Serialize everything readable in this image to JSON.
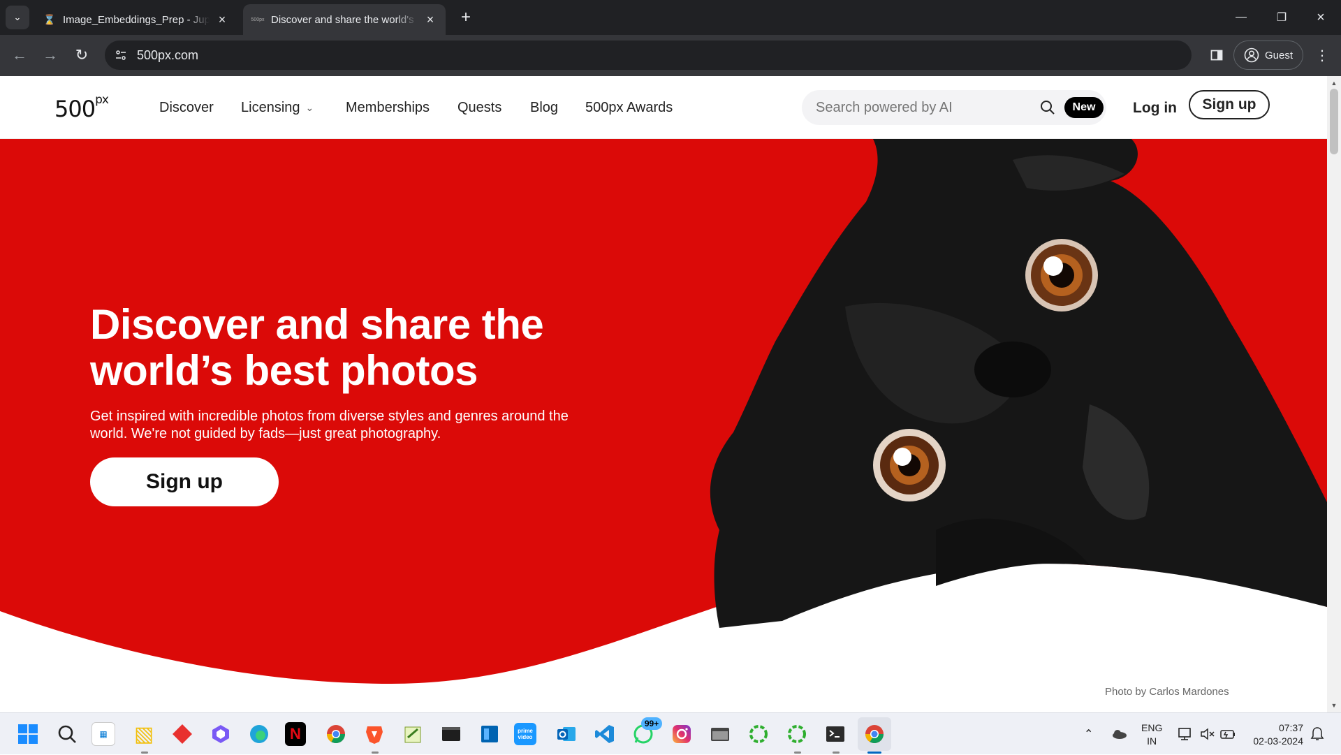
{
  "browser": {
    "tabs": [
      {
        "title": "Image_Embeddings_Prep - Jupyter",
        "icon": "hourglass-icon",
        "active": false
      },
      {
        "title": "Discover and share the world's best photos",
        "icon": "500px-favicon",
        "active": true
      }
    ],
    "new_tab_symbol": "+",
    "url": "500px.com",
    "profile_label": "Guest"
  },
  "site": {
    "logo_main": "500",
    "logo_sup": "px",
    "nav": [
      {
        "label": "Discover"
      },
      {
        "label": "Licensing",
        "has_dropdown": true
      },
      {
        "label": "Memberships"
      },
      {
        "label": "Quests"
      },
      {
        "label": "Blog"
      },
      {
        "label": "500px Awards"
      }
    ],
    "search_placeholder": "Search powered by AI",
    "new_badge": "New",
    "login_label": "Log in",
    "signup_label": "Sign up"
  },
  "hero": {
    "title": "Discover and share the world’s best photos",
    "subtitle": "Get inspired with incredible photos from diverse styles and genres around the world. We're not guided by fads—just great photography.",
    "cta_label": "Sign up",
    "photo_credit": "Photo by Carlos Mardones",
    "background_color": "#db0a08"
  },
  "taskbar": {
    "apps": [
      "windows-start-icon",
      "search-icon",
      "store-icon",
      "file-explorer-icon",
      "app-red-icon",
      "copilot-icon",
      "edge-icon",
      "netflix-icon",
      "chrome-icon",
      "brave-icon",
      "notepad-plus-icon",
      "terminal-icon",
      "app-blue-icon",
      "prime-video-icon",
      "outlook-icon",
      "vscode-icon",
      "whatsapp-icon",
      "instagram-icon",
      "app-window-icon",
      "loading-green-icon",
      "loading-green-icon-2",
      "powershell-icon",
      "chrome-active-icon"
    ],
    "whatsapp_badge": "99+",
    "language_line1": "ENG",
    "language_line2": "IN",
    "time": "07:37",
    "date": "02-03-2024"
  }
}
